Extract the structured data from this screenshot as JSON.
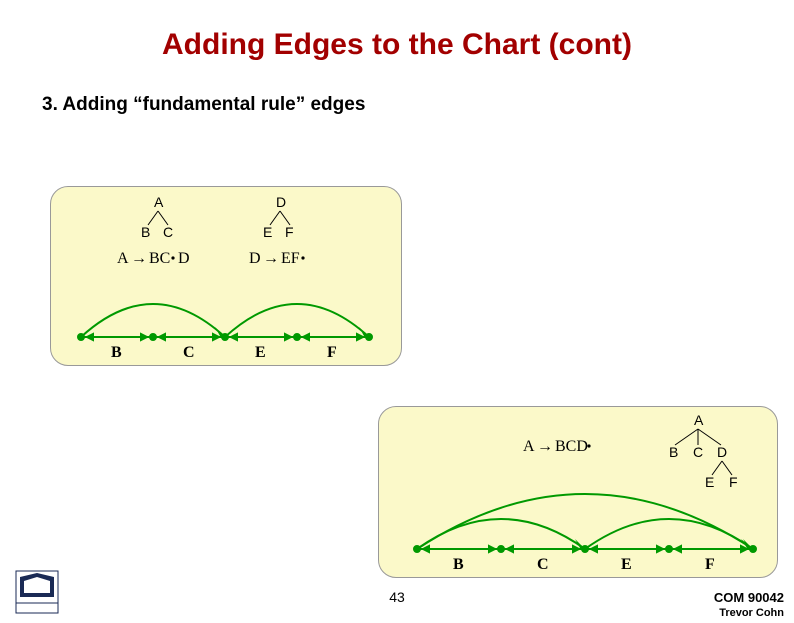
{
  "title": "Adding Edges to the Chart (cont)",
  "subtitle": "3. Adding “fundamental rule” edges",
  "panel1": {
    "tree1": {
      "root": "A",
      "children": [
        "B",
        "C"
      ]
    },
    "tree2": {
      "root": "D",
      "children": [
        "E",
        "F"
      ]
    },
    "rule1": {
      "lhs": "A",
      "rhs_before": "BC",
      "rhs_after": "D"
    },
    "rule2": {
      "lhs": "D",
      "rhs_before": "EF",
      "rhs_after": ""
    },
    "nodes": [
      "B",
      "C",
      "E",
      "F"
    ]
  },
  "panel2": {
    "tree": {
      "root": "A",
      "children": [
        "B",
        "C",
        "D"
      ],
      "d_children": [
        "E",
        "F"
      ]
    },
    "rule": {
      "lhs": "A",
      "rhs_before": "BCD",
      "rhs_after": ""
    },
    "nodes": [
      "B",
      "C",
      "E",
      "F"
    ]
  },
  "footer": {
    "slide_number": "43",
    "course_code": "COM 90042",
    "author": "Trevor Cohn"
  },
  "colors": {
    "title": "#a20000",
    "panel_bg": "#fbf9c9",
    "edge_green": "#009900",
    "tree_black": "#000000"
  }
}
